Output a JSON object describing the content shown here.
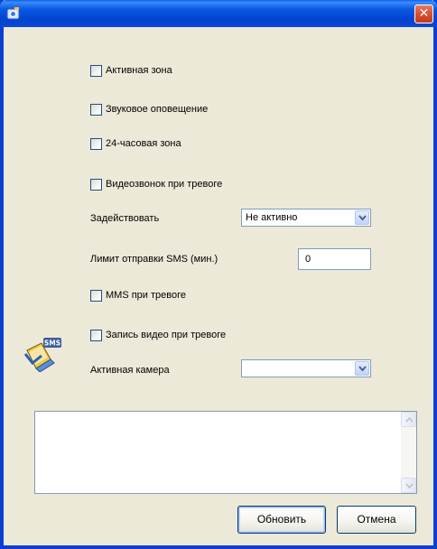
{
  "window": {
    "close_symbol": "✕"
  },
  "options": {
    "active_zone": "Активная зона",
    "sound_alert": "Звуковое оповещение",
    "zone_24h": "24-часовая зона",
    "video_call_on_alarm": "Видеозвонок при тревоге",
    "mms_on_alarm": "MMS при тревоге",
    "record_video_on_alarm": "Запись видео при тревоге"
  },
  "activate": {
    "label": "Задействовать",
    "value": "Не активно"
  },
  "sms_limit": {
    "label": "Лимит отправки SMS (мин.)",
    "value": "0"
  },
  "camera": {
    "label": "Активная камера",
    "value": ""
  },
  "icon": {
    "badge": "SMS"
  },
  "buttons": {
    "update": "Обновить",
    "cancel": "Отмена"
  }
}
